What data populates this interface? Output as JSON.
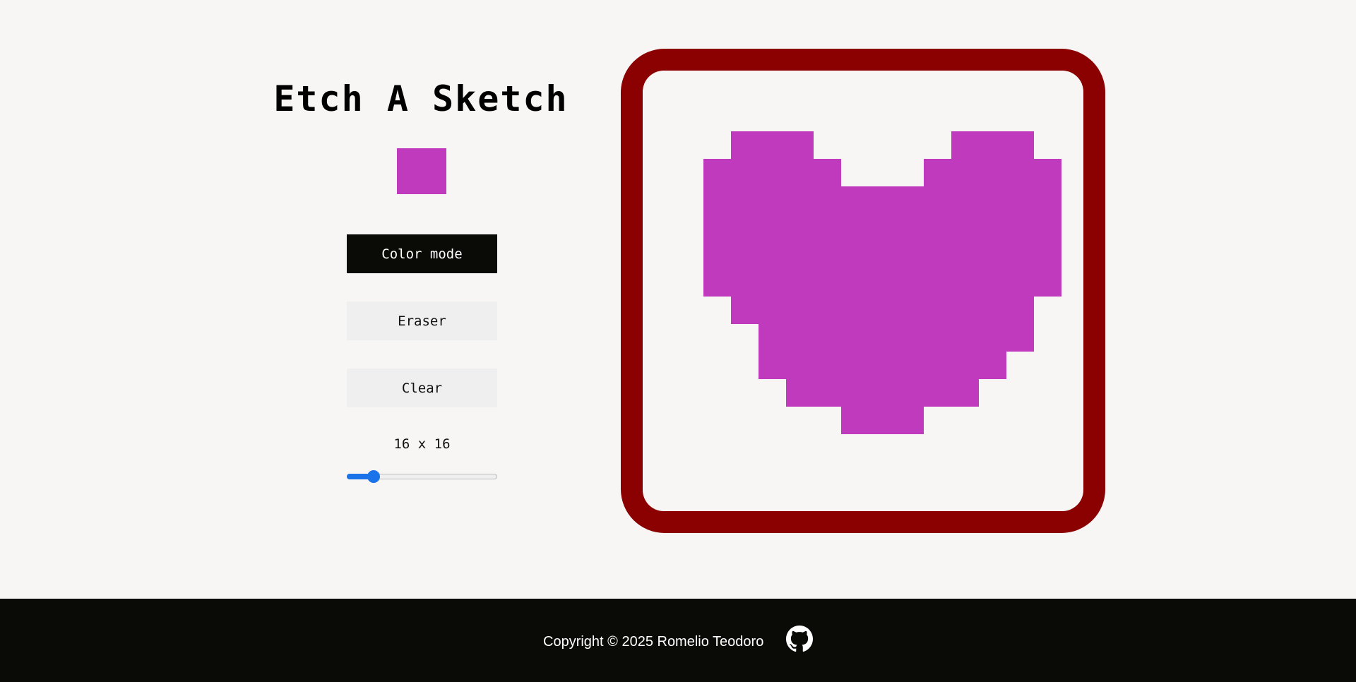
{
  "app": {
    "title": "Etch A Sketch"
  },
  "controls": {
    "current_color": "#bf3abd",
    "color_mode_label": "Color mode",
    "eraser_label": "Eraser",
    "clear_label": "Clear",
    "grid_size_label": "16 x 16",
    "grid_size": 16,
    "grid_size_range": [
      1,
      100
    ]
  },
  "canvas": {
    "frame_color": "#8b0000",
    "background_color": "#f8f6f5",
    "paint_color": "#bf3abd",
    "rows": [
      "0000000000000000",
      "0011100000111000",
      "0111110001111100",
      "0111111111111100",
      "0111111111111100",
      "0111111111111100",
      "0111111111111100",
      "0011111111111000",
      "0001111111111000",
      "0001111111110000",
      "0000111111100000",
      "0000001110000000",
      "0000000000000000",
      "0000000000000000",
      "0000000000000000",
      "0000000000000000"
    ]
  },
  "footer": {
    "copyright": "Copyright © 2025 Romelio Teodoro",
    "github_icon": "github-icon"
  }
}
